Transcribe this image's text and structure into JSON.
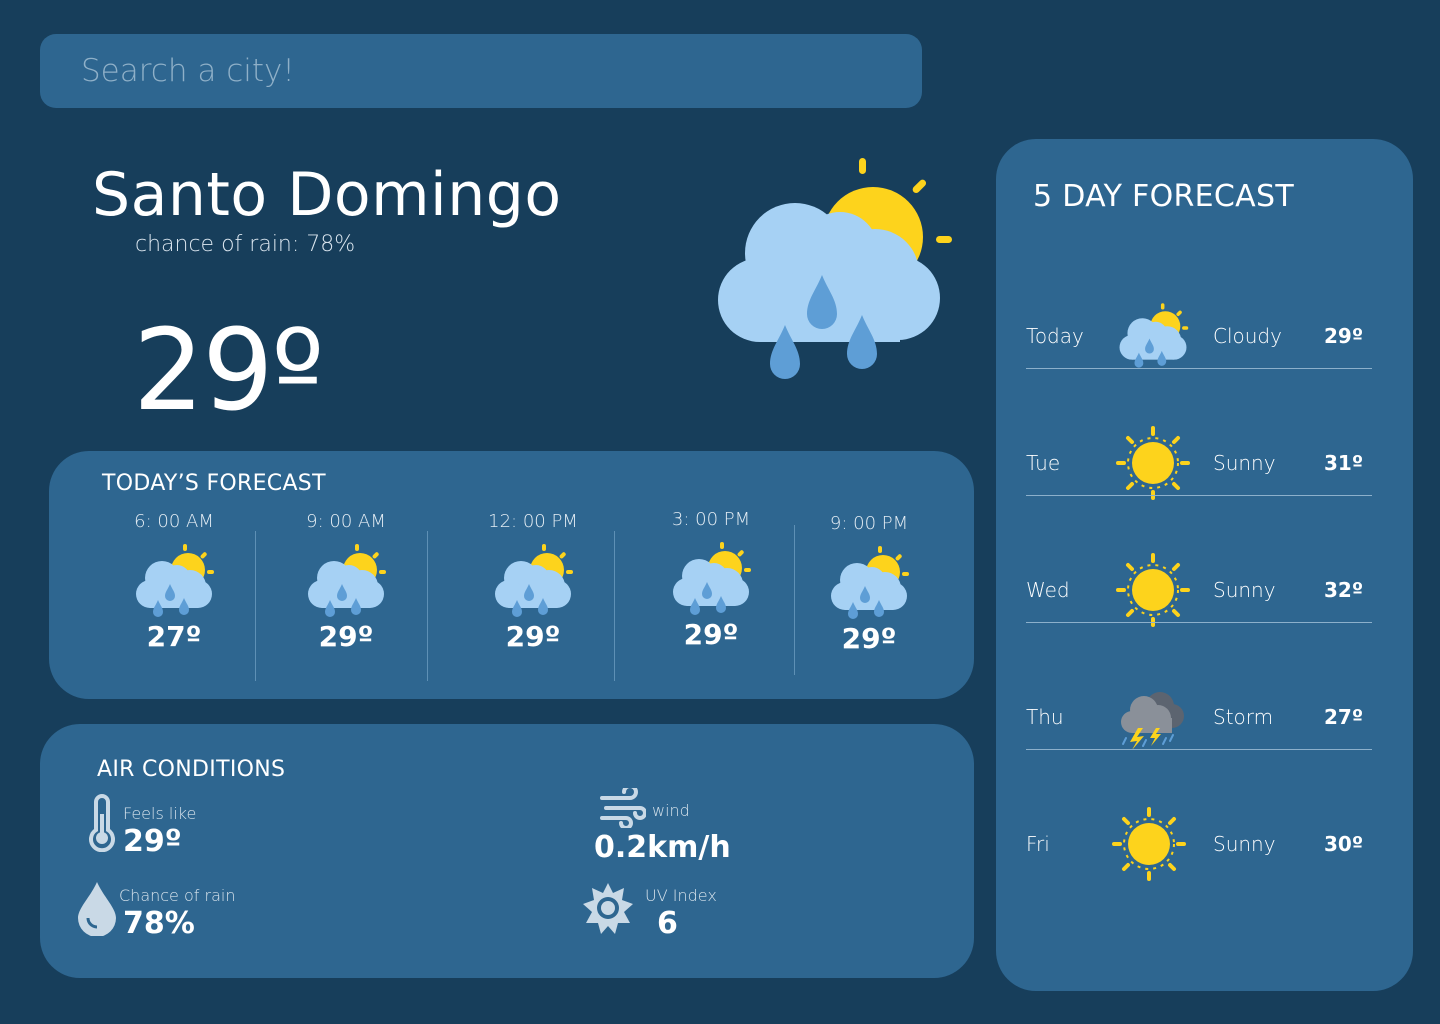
{
  "search": {
    "placeholder": "Search a city!"
  },
  "current": {
    "city": "Santo Domingo",
    "rain_chance_text": "chance of rain: 78%",
    "temperature": "29º",
    "icon": "rain-sun-cloud-icon"
  },
  "today_forecast": {
    "title": "TODAY’S FORECAST",
    "hours": [
      {
        "time": "6: 00 AM",
        "temp": "27º",
        "icon": "rain-sun-cloud-icon"
      },
      {
        "time": "9: 00 AM",
        "temp": "29º",
        "icon": "rain-sun-cloud-icon"
      },
      {
        "time": "12: 00 PM",
        "temp": "29º",
        "icon": "rain-sun-cloud-icon"
      },
      {
        "time": "3: 00 PM",
        "temp": "29º",
        "icon": "rain-sun-cloud-icon"
      },
      {
        "time": "9: 00 PM",
        "temp": "29º",
        "icon": "rain-sun-cloud-icon"
      }
    ]
  },
  "air_conditions": {
    "title": "AIR CONDITIONS",
    "feels_like": {
      "label": "Feels like",
      "value": "29º",
      "icon": "thermometer-icon"
    },
    "wind": {
      "label": "wind",
      "value": "0.2km/h",
      "icon": "wind-icon"
    },
    "chance_of_rain": {
      "label": "Chance of rain",
      "value": "78%",
      "icon": "water-drop-icon"
    },
    "uv_index": {
      "label": "UV Index",
      "value": "6",
      "icon": "sun-uv-icon"
    }
  },
  "five_day": {
    "title": "5 DAY FORECAST",
    "days": [
      {
        "day": "Today",
        "condition": "Cloudy",
        "temp": "29º",
        "icon": "rain-sun-cloud-icon"
      },
      {
        "day": "Tue",
        "condition": "Sunny",
        "temp": "31º",
        "icon": "sun-icon"
      },
      {
        "day": "Wed",
        "condition": "Sunny",
        "temp": "32º",
        "icon": "sun-icon"
      },
      {
        "day": "Thu",
        "condition": "Storm",
        "temp": "27º",
        "icon": "storm-cloud-icon"
      },
      {
        "day": "Fri",
        "condition": "Sunny",
        "temp": "30º",
        "icon": "sun-icon"
      }
    ]
  },
  "colors": {
    "background": "#173e5b",
    "card": "#2e6690",
    "sun": "#fdd31c",
    "cloud": "#a6d1f4",
    "raindrop": "#5e9ed6"
  }
}
